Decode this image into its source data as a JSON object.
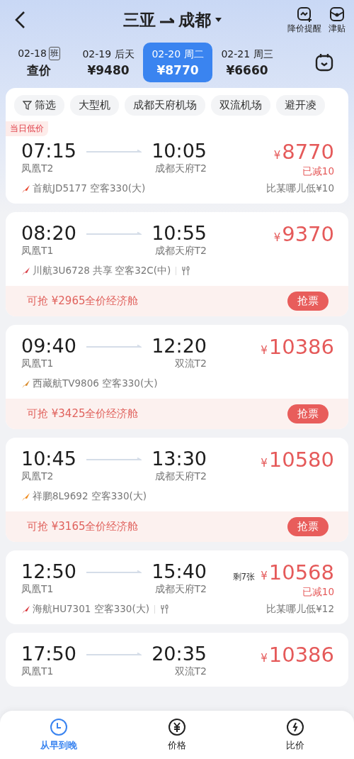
{
  "header": {
    "from": "三亚",
    "to": "成都",
    "actions": [
      {
        "kind": "alert",
        "label": "降价提醒"
      },
      {
        "kind": "allowance",
        "label": "津贴"
      }
    ]
  },
  "dates": [
    {
      "date": "02-18",
      "badge": "班",
      "price": "查价",
      "selected": false
    },
    {
      "date": "02-19 后天",
      "price": "¥9480",
      "selected": false
    },
    {
      "date": "02-20 周二",
      "price": "¥8770",
      "selected": true
    },
    {
      "date": "02-21 周三",
      "price": "¥6660",
      "selected": false
    }
  ],
  "filters": [
    {
      "label": "筛选",
      "kind": "filter"
    },
    {
      "label": "大型机",
      "kind": "chip"
    },
    {
      "label": "成都天府机场",
      "kind": "chip"
    },
    {
      "label": "双流机场",
      "kind": "chip"
    },
    {
      "label": "避开凌",
      "kind": "chip"
    }
  ],
  "flights": [
    {
      "tag": "当日低价",
      "dep": "07:15",
      "arr": "10:05",
      "dep_terminal": "凤凰T2",
      "arr_terminal": "成都天府T2",
      "airline": "首航JD5177 空客330(大)",
      "color": "#e8452c",
      "currency": "¥",
      "price": "8770",
      "discount": "已减10",
      "compare": "比某哪儿低¥10"
    },
    {
      "dep": "08:20",
      "arr": "10:55",
      "dep_terminal": "凤凰T1",
      "arr_terminal": "成都天府T2",
      "airline": "川航3U6728 共享",
      "aircraft": "空客32C(中)",
      "meal": true,
      "color": "#d9414a",
      "currency": "¥",
      "price": "9370",
      "promo": "可抢 ¥2965全价经济舱",
      "promo_button": "抢票"
    },
    {
      "dep": "09:40",
      "arr": "12:20",
      "dep_terminal": "凤凰T1",
      "arr_terminal": "双流T2",
      "airline": "西藏航TV9806 空客330(大)",
      "color": "#d98a2b",
      "currency": "¥",
      "price": "10386",
      "promo": "可抢 ¥3425全价经济舱",
      "promo_button": "抢票"
    },
    {
      "dep": "10:45",
      "arr": "13:30",
      "dep_terminal": "凤凰T2",
      "arr_terminal": "成都天府T2",
      "airline": "祥鹏8L9692 空客330(大)",
      "color": "#f08a1c",
      "currency": "¥",
      "price": "10580",
      "promo": "可抢 ¥3165全价经济舱",
      "promo_button": "抢票"
    },
    {
      "dep": "12:50",
      "arr": "15:40",
      "dep_terminal": "凤凰T1",
      "arr_terminal": "成都天府T2",
      "airline": "海航HU7301 空客330(大)",
      "meal": true,
      "color": "#d8343a",
      "seats": "剩7张",
      "currency": "¥",
      "price": "10568",
      "discount": "已减10",
      "compare": "比某哪儿低¥12"
    },
    {
      "dep": "17:50",
      "arr": "20:35",
      "dep_terminal": "凤凰T1",
      "arr_terminal": "双流T2",
      "currency": "¥",
      "price": "10386"
    }
  ],
  "bottom_nav": [
    {
      "kind": "clock",
      "label": "从早到晚",
      "selected": true
    },
    {
      "kind": "yuan",
      "label": "价格",
      "selected": false
    },
    {
      "kind": "compare",
      "label": "比价",
      "selected": false
    }
  ]
}
